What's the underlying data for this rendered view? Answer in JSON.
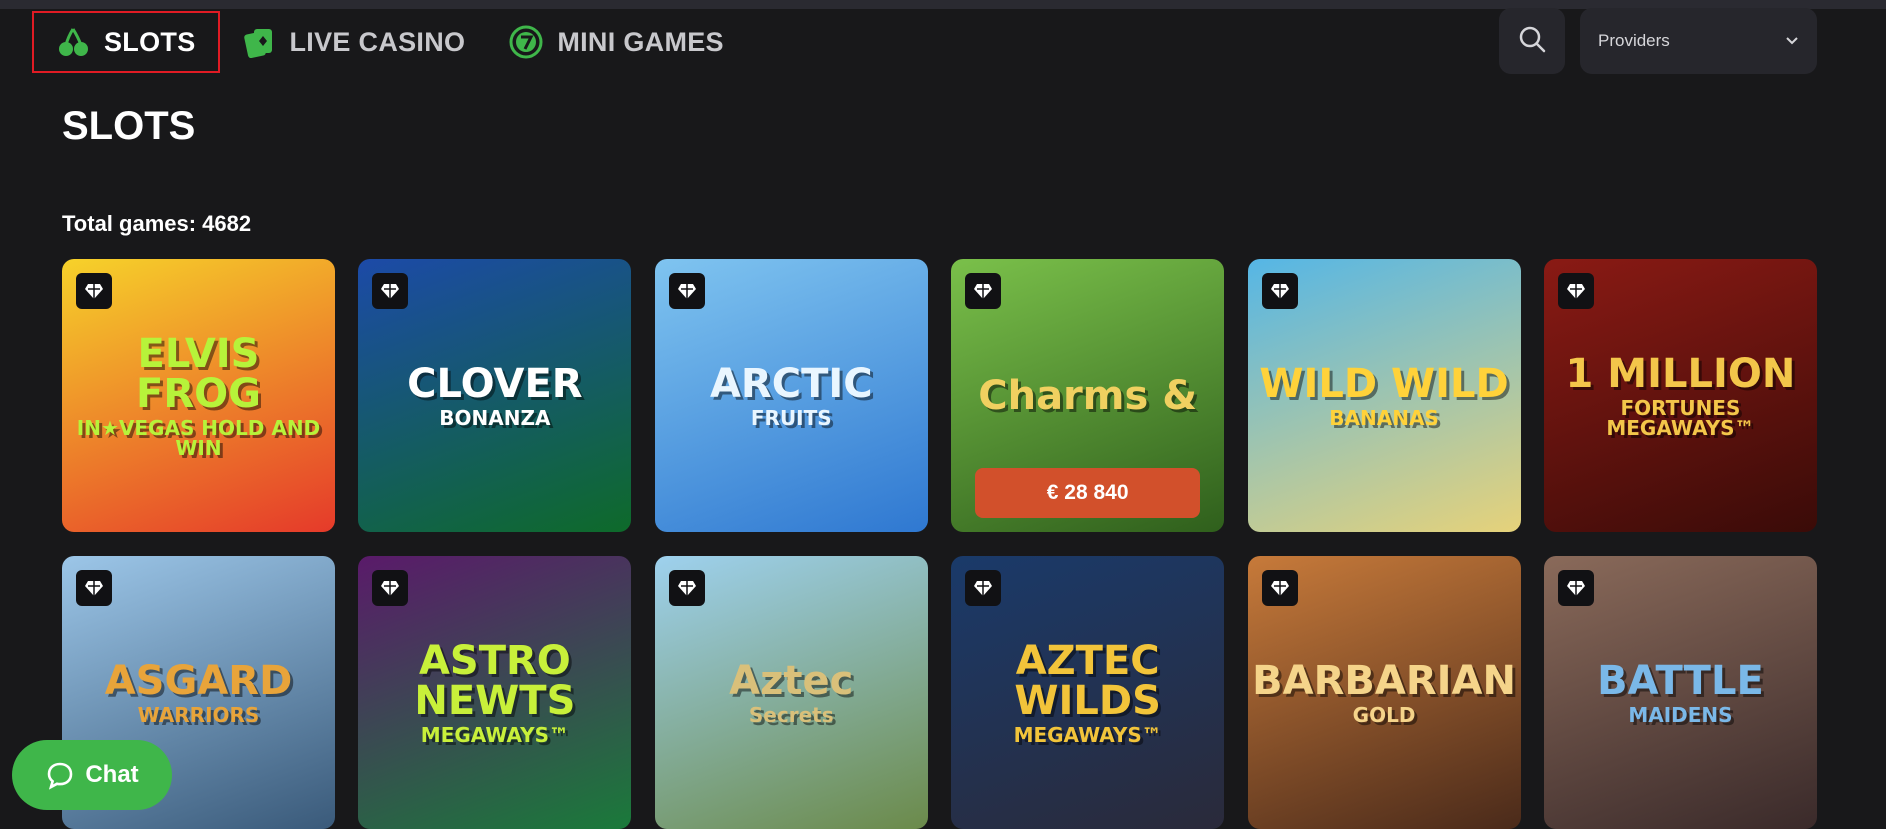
{
  "nav": {
    "items": [
      {
        "label": "SLOTS",
        "icon": "cherry-icon",
        "active": true
      },
      {
        "label": "LIVE CASINO",
        "icon": "cards-icon",
        "active": false
      },
      {
        "label": "MINI GAMES",
        "icon": "seven-coin-icon",
        "active": false
      }
    ]
  },
  "providers": {
    "label": "Providers"
  },
  "page": {
    "title": "SLOTS",
    "total": "Total games: 4682"
  },
  "games": [
    {
      "title": "ELVIS FROG",
      "sub": "IN★VEGAS HOLD AND WIN",
      "bg": "linear-gradient(160deg,#f6d22a,#e53a2a)",
      "color": "#b7f33a"
    },
    {
      "title": "CLOVER",
      "sub": "BONANZA",
      "bg": "linear-gradient(160deg,#1c4aa8,#0e6a2a)",
      "color": "#ffffff"
    },
    {
      "title": "ARCTIC",
      "sub": "FRUITS",
      "bg": "linear-gradient(160deg,#7fc4f0,#2f78d1)",
      "color": "#e9f6ff"
    },
    {
      "title": "Charms &",
      "sub": "",
      "bg": "linear-gradient(160deg,#7ac04a,#2f5f1c)",
      "color": "#f0d060",
      "jackpot": "€ 28 840"
    },
    {
      "title": "WILD WILD",
      "sub": "BANANAS",
      "bg": "linear-gradient(160deg,#55b6e6,#e6d27a)",
      "color": "#ffd23a"
    },
    {
      "title": "1 MILLION",
      "sub": "FORTUNES MEGAWAYS™",
      "bg": "linear-gradient(160deg,#8a1a14,#3a0b08)",
      "color": "#f3c64a"
    },
    {
      "title": "ASGARD",
      "sub": "WARRIORS",
      "bg": "linear-gradient(160deg,#9cc6e8,#3a5a7a)",
      "color": "#e8a43a"
    },
    {
      "title": "ASTRO NEWTS",
      "sub": "MEGAWAYS™",
      "bg": "linear-gradient(160deg,#5a1a6a,#1a7a3a)",
      "color": "#c8f03a"
    },
    {
      "title": "Aztec",
      "sub": "Secrets",
      "bg": "linear-gradient(160deg,#9ed1ee,#6b8a4a)",
      "color": "#d9c07a"
    },
    {
      "title": "AZTEC WILDS",
      "sub": "MEGAWAYS™",
      "bg": "linear-gradient(160deg,#1a3a6a,#2a2a3a)",
      "color": "#f2c43a"
    },
    {
      "title": "BARBARIAN",
      "sub": "GOLD",
      "bg": "linear-gradient(160deg,#c77a3a,#4a2a1a)",
      "color": "#f5d48a"
    },
    {
      "title": "BATTLE",
      "sub": "MAIDENS",
      "bg": "linear-gradient(160deg,#8a6a5a,#3a2a2a)",
      "color": "#7ab8e8"
    }
  ],
  "chat": {
    "label": "Chat"
  },
  "colors": {
    "accent": "#3fb64a",
    "active_border": "#e01b24",
    "jackpot": "#d2502b"
  }
}
